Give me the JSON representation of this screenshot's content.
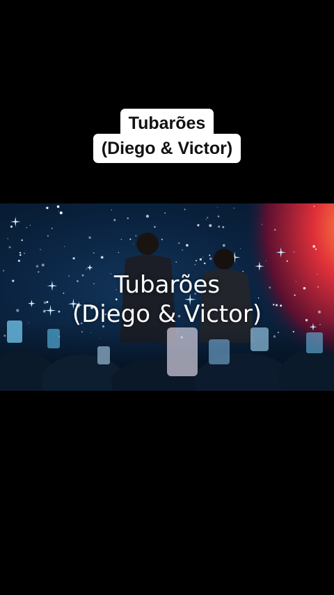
{
  "caption": {
    "line1": "Tubarões",
    "line2": "(Diego & Victor)"
  },
  "video": {
    "overlay_line1": "Tubarões",
    "overlay_line2": "(Diego & Victor)",
    "colors": {
      "background": "#000000",
      "stage_blue": "#0a2340",
      "screen_red": "#e0303a",
      "screen_orange": "#ff8a3a"
    }
  }
}
